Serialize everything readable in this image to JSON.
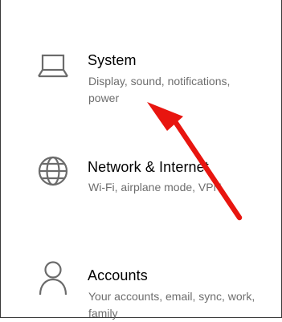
{
  "settings": {
    "items": [
      {
        "title": "System",
        "description": "Display, sound, notifications, power",
        "icon": "laptop-icon"
      },
      {
        "title": "Network & Internet",
        "description": "Wi-Fi, airplane mode, VPN",
        "icon": "globe-icon"
      },
      {
        "title": "Accounts",
        "description": "Your accounts, email, sync, work, family",
        "icon": "person-icon"
      }
    ]
  },
  "colors": {
    "arrow": "#e8150f",
    "icon": "#6b6b6b",
    "title": "#000000",
    "description": "#6d6d6d"
  }
}
